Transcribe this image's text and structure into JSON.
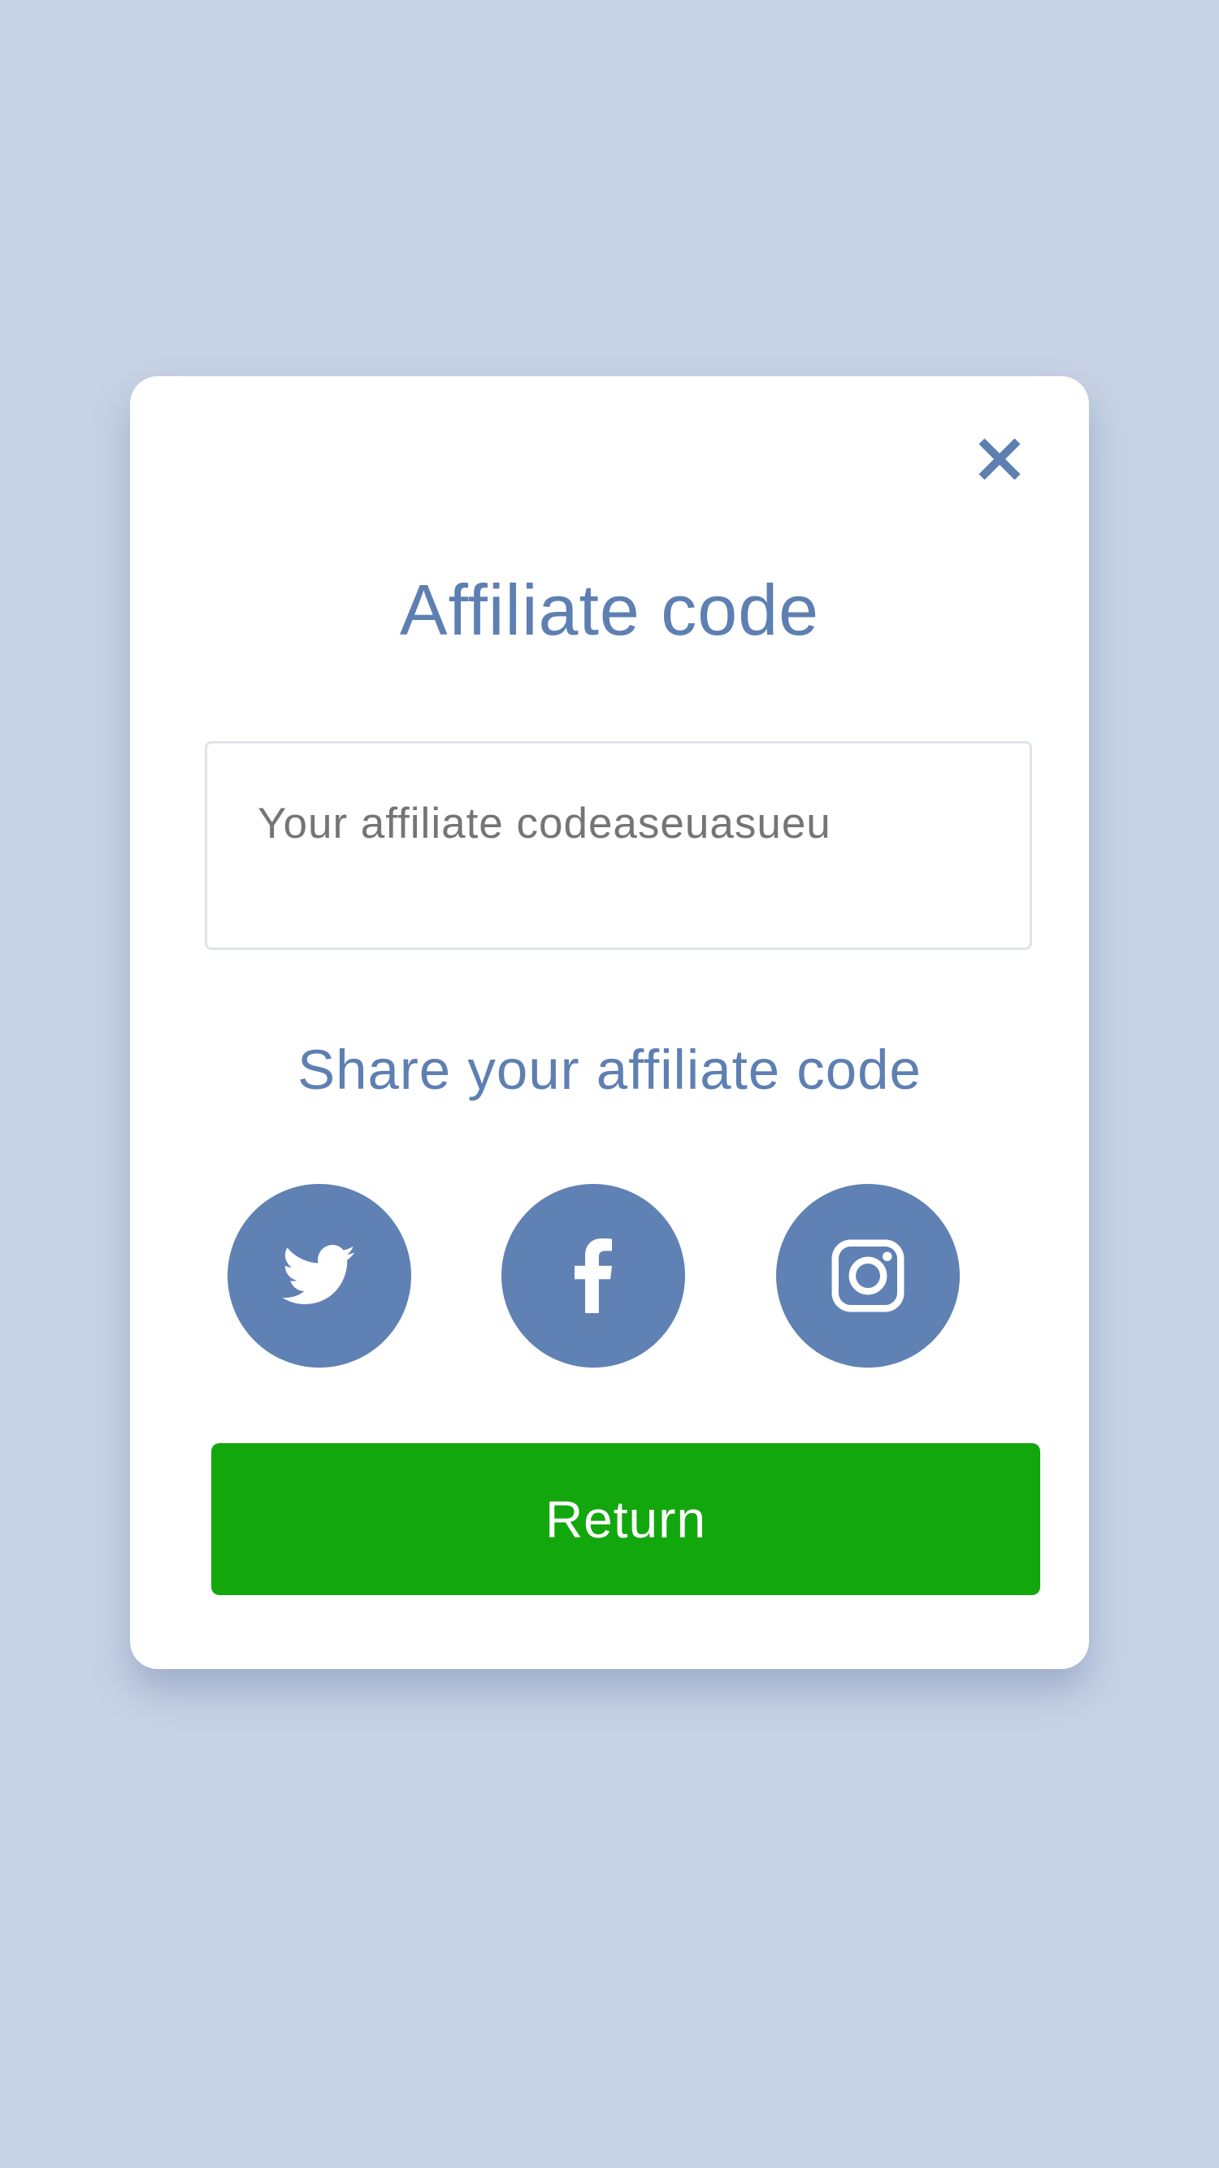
{
  "modal": {
    "close_icon": "close-icon",
    "title": "Affiliate code",
    "code_field": {
      "placeholder": "Your affiliate codeaseuasueu",
      "value": ""
    },
    "share_heading": "Share your affiliate code",
    "share_buttons": [
      {
        "icon": "twitter-icon"
      },
      {
        "icon": "facebook-icon"
      },
      {
        "icon": "instagram-icon"
      }
    ],
    "return_label": "Return"
  },
  "colors": {
    "background": "#c7d2e4",
    "card": "#ffffff",
    "accent_blue": "#5e7fb2",
    "social_circle": "#6081b4",
    "return_green": "#13a70e",
    "placeholder_gray": "#8e8e8e",
    "field_border": "#dfe3ea"
  }
}
